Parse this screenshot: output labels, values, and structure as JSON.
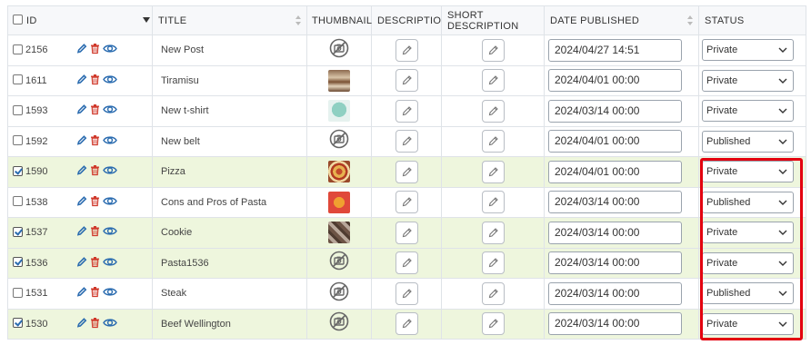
{
  "columns": {
    "id": "ID",
    "title": "TITLE",
    "thumbnail": "THUMBNAIL",
    "description": "DESCRIPTION",
    "short_description": "SHORT DESCRIPTION",
    "date_published": "DATE PUBLISHED",
    "status": "STATUS"
  },
  "rows": [
    {
      "id": "2156",
      "title": "New Post",
      "thumbnail": "no-image-icon",
      "date": "2024/04/27 14:51",
      "status": "Private",
      "checked": false
    },
    {
      "id": "1611",
      "title": "Tiramisu",
      "thumbnail": "tiramisu-thumbnail",
      "date": "2024/04/01 00:00",
      "status": "Private",
      "checked": false
    },
    {
      "id": "1593",
      "title": "New t-shirt",
      "thumbnail": "t-shirt-thumbnail",
      "date": "2024/03/14 00:00",
      "status": "Private",
      "checked": false
    },
    {
      "id": "1592",
      "title": "New belt",
      "thumbnail": "no-image-icon",
      "date": "2024/04/01 00:00",
      "status": "Published",
      "checked": false
    },
    {
      "id": "1590",
      "title": "Pizza",
      "thumbnail": "pizza-thumbnail",
      "date": "2024/04/01 00:00",
      "status": "Private",
      "checked": true
    },
    {
      "id": "1538",
      "title": "Cons and Pros of Pasta",
      "thumbnail": "pasta-thumbnail",
      "date": "2024/03/14 00:00",
      "status": "Published",
      "checked": false
    },
    {
      "id": "1537",
      "title": "Cookie",
      "thumbnail": "cookie-thumbnail",
      "date": "2024/03/14 00:00",
      "status": "Private",
      "checked": true
    },
    {
      "id": "1536",
      "title": "Pasta1536",
      "thumbnail": "no-image-icon",
      "date": "2024/03/14 00:00",
      "status": "Private",
      "checked": true
    },
    {
      "id": "1531",
      "title": "Steak",
      "thumbnail": "no-image-icon",
      "date": "2024/03/14 00:00",
      "status": "Published",
      "checked": false
    },
    {
      "id": "1530",
      "title": "Beef Wellington",
      "thumbnail": "no-image-icon",
      "date": "2024/03/14 00:00",
      "status": "Private",
      "checked": true
    }
  ],
  "colors": {
    "selected_row": "#eef6dd",
    "action_blue": "#2b6cb0",
    "delete_red": "#d0392b",
    "highlight_border": "#e3000f"
  }
}
